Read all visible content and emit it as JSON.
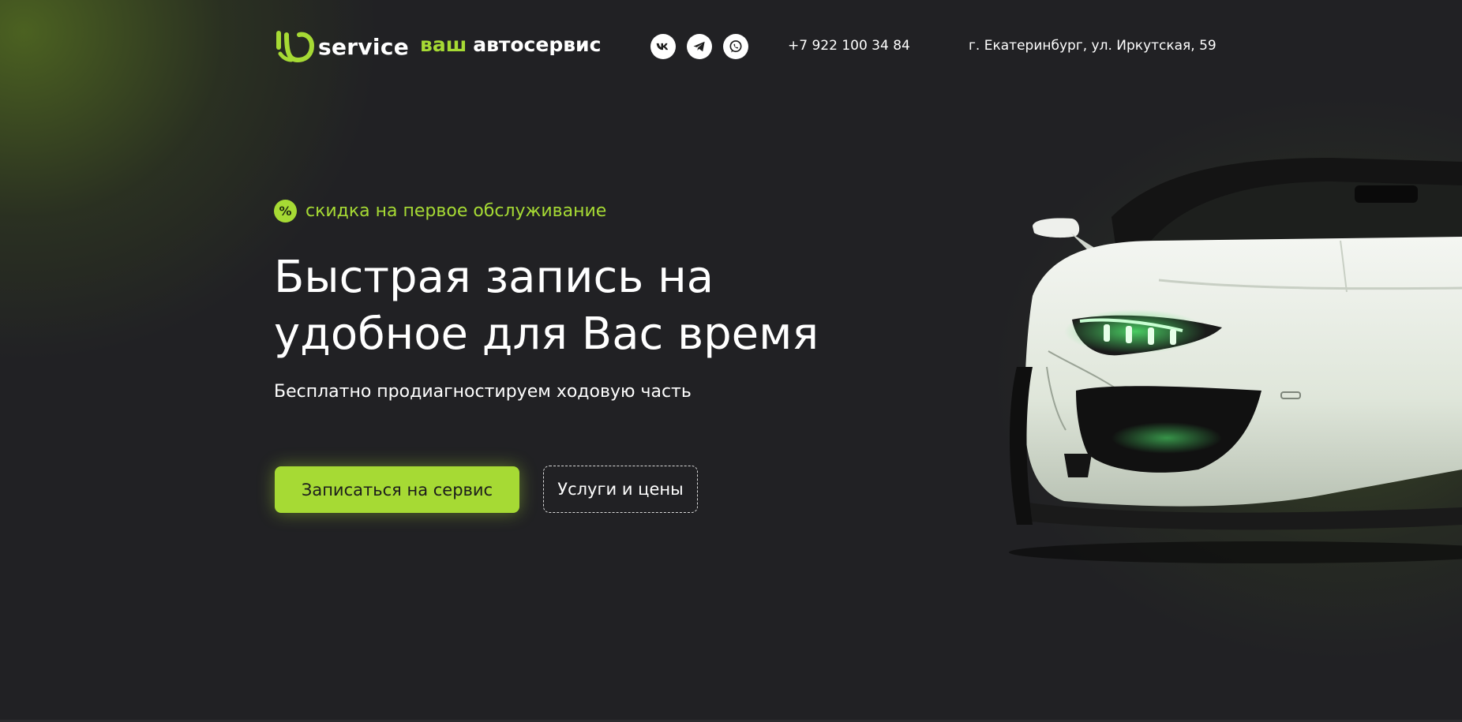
{
  "header": {
    "logo_text": "service",
    "tagline_accent": "ваш",
    "tagline_rest": "автосервис",
    "socials": [
      {
        "name": "vk-icon"
      },
      {
        "name": "telegram-icon"
      },
      {
        "name": "whatsapp-icon"
      }
    ],
    "phone": "+7 922 100 34 84",
    "address": "г. Екатеринбург, ул. Иркутская, 59"
  },
  "hero": {
    "discount_icon": "%",
    "discount_text": "скидка на первое обслуживание",
    "title": "Быстрая запись на удобное для Вас время",
    "subtitle": "Бесплатно продиагностируем ходовую часть",
    "primary_button": "Записаться на сервис",
    "secondary_button": "Услуги и цены"
  },
  "colors": {
    "accent": "#a6da34",
    "background": "#212124",
    "text": "#ffffff"
  }
}
